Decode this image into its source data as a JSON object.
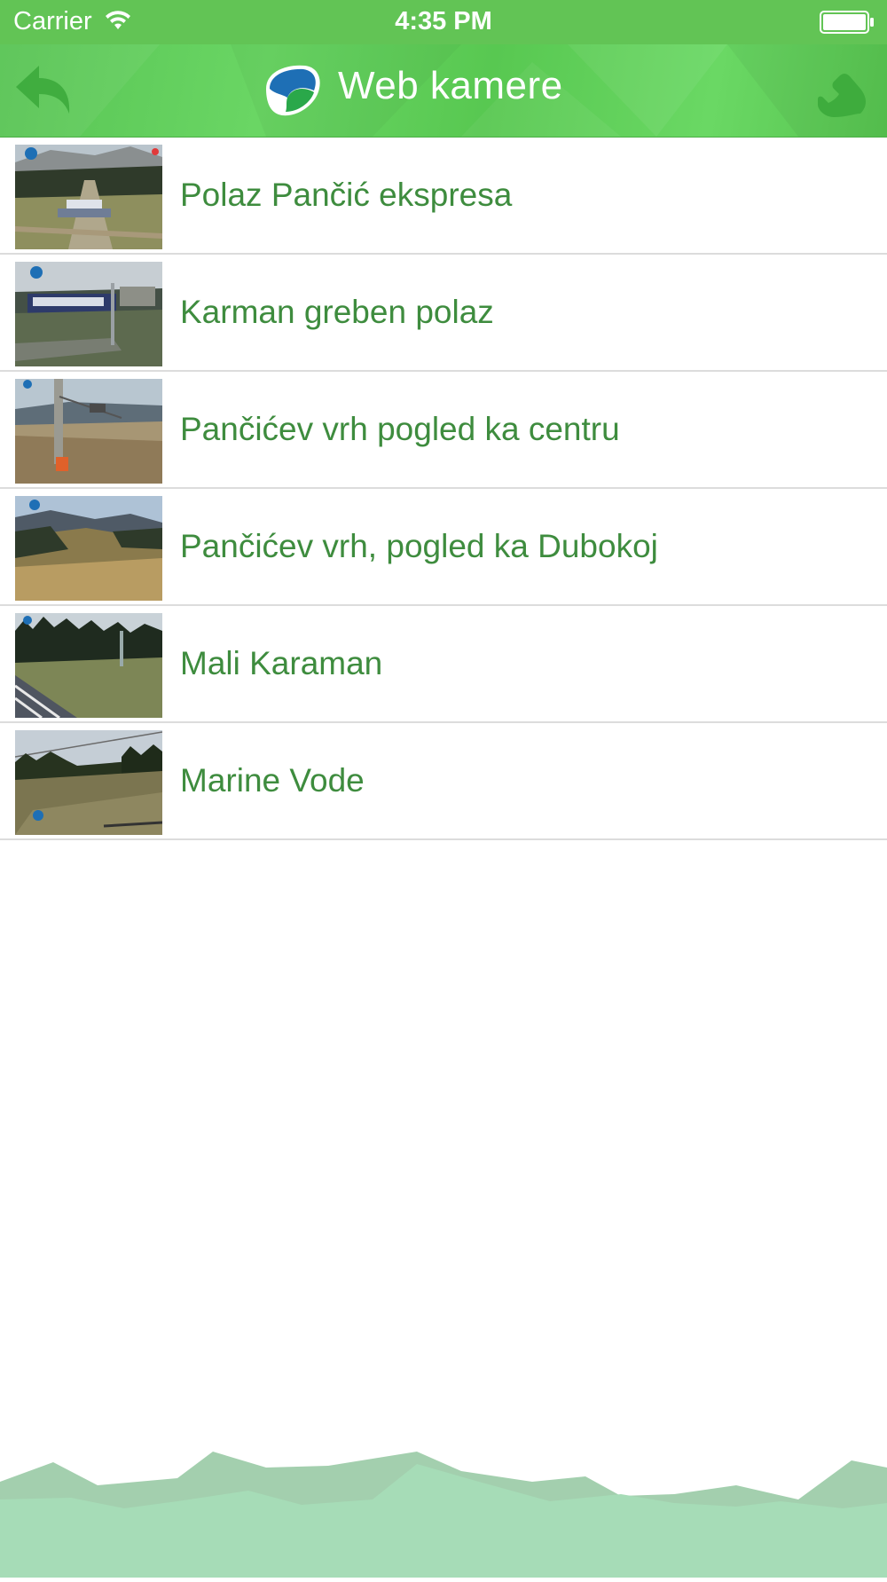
{
  "status_bar": {
    "carrier": "Carrier",
    "time": "4:35 PM",
    "wifi_icon": "wifi-icon",
    "battery_icon": "battery-icon"
  },
  "nav": {
    "title": "Web kamere",
    "back_icon": "back-arrow-icon",
    "phone_icon": "phone-icon",
    "logo_icon": "kopaonik-logo-icon",
    "accent_color": "#5fcf57"
  },
  "cameras": [
    {
      "label": "Polaz Pančić ekspresa"
    },
    {
      "label": "Karman greben polaz"
    },
    {
      "label": "Pančićev vrh pogled ka centru"
    },
    {
      "label": "Pančićev vrh, pogled ka Dubokoj"
    },
    {
      "label": "Mali Karaman"
    },
    {
      "label": "Marine Vode"
    }
  ],
  "colors": {
    "label_text": "#3e8c3e",
    "divider": "#dcdcdc",
    "mountain_light": "#a8dcb4",
    "mountain_dark": "#9ecca8"
  }
}
